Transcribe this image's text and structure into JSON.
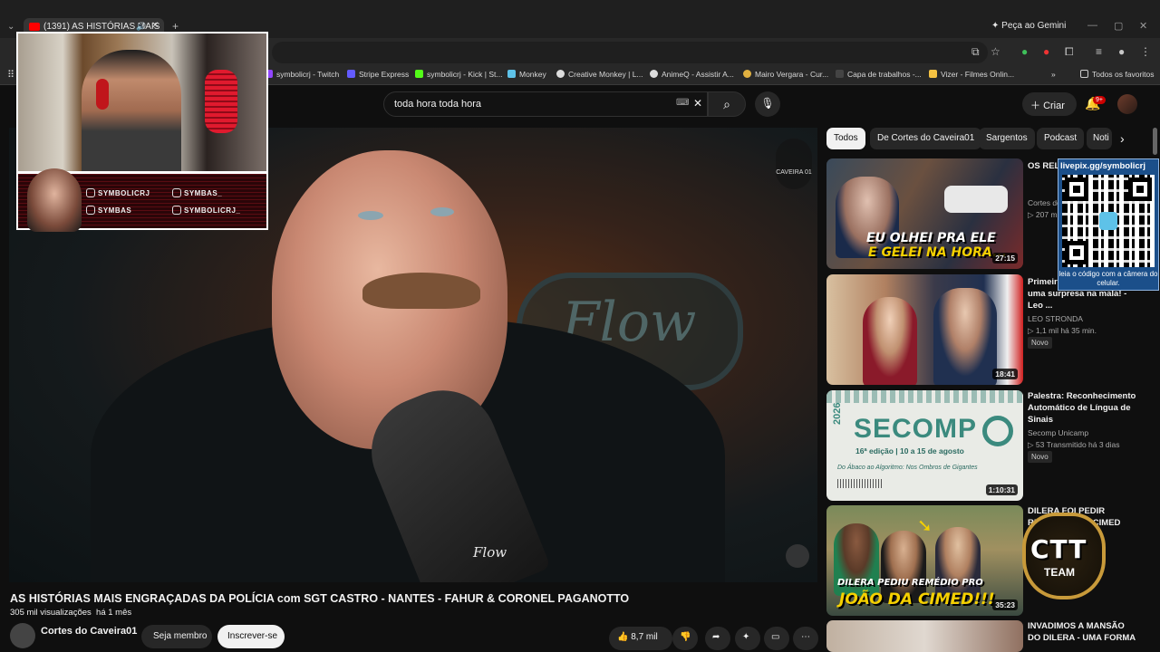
{
  "browser": {
    "tab_title": "(1391) AS HISTÓRIAS MAIS",
    "gemini_label": "Peça ao Gemini",
    "bookmarks": [
      {
        "label": "symbolicrj - Twitch",
        "color": "#9146ff"
      },
      {
        "label": "Stripe Express",
        "color": "#635bff"
      },
      {
        "label": "symbolicrj - Kick | St...",
        "color": "#53fc18"
      },
      {
        "label": "Monkey",
        "color": "#5ec2e8"
      },
      {
        "label": "Creative Monkey | L...",
        "color": "#dddddd"
      },
      {
        "label": "AnimeQ - Assistir A...",
        "color": "#dddddd"
      },
      {
        "label": "Mairo Vergara - Cur...",
        "color": "#e0b040"
      },
      {
        "label": "Capa de trabalhos -...",
        "color": "#444444"
      },
      {
        "label": "Vizer - Filmes Onlin...",
        "color": "#f5c242"
      }
    ],
    "all_favorites": "Todos os favoritos"
  },
  "masthead": {
    "search_value": "toda hora toda hora",
    "create_label": "Criar",
    "notif_count": "9+"
  },
  "overlay": {
    "socials": [
      {
        "label": "SYMBOLICRJ",
        "icon": "twitch-icon"
      },
      {
        "label": "SYMBAS_",
        "icon": "tiktok-icon"
      },
      {
        "label": "SYMBAS",
        "icon": "youtube-icon"
      },
      {
        "label": "SYMBOLICRJ_",
        "icon": "instagram-icon"
      }
    ],
    "qr_url": "livepix.gg/symbolicrj",
    "qr_hint": "leia o código com a câmera do celular.",
    "logo_main": "CTT",
    "logo_sub": "TEAM"
  },
  "player": {
    "watermark": "CAVEIRA 01",
    "sign_text": "Flow",
    "mic_text": "Flow"
  },
  "video": {
    "title": "AS HISTÓRIAS MAIS ENGRAÇADAS DA POLÍCIA com SGT CASTRO - NANTES - FAHUR & CORONEL PAGANOTTO",
    "views": "305 mil visualizações",
    "age": "há 1 mês",
    "channel": "Cortes do Caveira01",
    "join_label": "Seja membro",
    "subscribe_label": "Inscrever-se",
    "likes": "8,7 mil"
  },
  "chips": [
    "Todos",
    "De Cortes do Caveira01",
    "Sargentos",
    "Podcast",
    "Noti"
  ],
  "recommendations": [
    {
      "title": "OS REL ABSUR CORON",
      "channel": "Cortes do",
      "stats": "207 m",
      "duration": "27:15",
      "caption1": "EU OLHEI PRA ELE",
      "caption2": "E GELEI NA HORA..."
    },
    {
      "title": "Primeir lugares incríveis e uma surpresa na mala! - Leo ...",
      "channel": "LEO STRONDA",
      "stats": "1,1 mil  há 35 min.",
      "badge": "Novo",
      "duration": "18:41"
    },
    {
      "title": "Palestra: Reconhecimento Automático de Língua de Sinais",
      "channel": "Secomp Unicamp",
      "stats": "53  Transmitido há 3 dias",
      "badge": "Novo",
      "duration": "1:10:31",
      "thumb_year": "2026",
      "thumb_name": "SECOMP",
      "thumb_dates": "16ª edição | 10 a 15 de agosto",
      "thumb_tagline": "Do Ábaco ao Algoritmo: Nos Ombros de Gigantes"
    },
    {
      "title": "DILERA FOI PEDIR REMÉDIO P DA CIMED",
      "duration": "35:23",
      "caption1": "DILERA PEDIU REMÉDIO PRO",
      "caption2": "JOÃO DA CIMED!!!"
    },
    {
      "title": "INVADIMOS A MANSÃO DO DILERA - UMA FORMA"
    }
  ]
}
